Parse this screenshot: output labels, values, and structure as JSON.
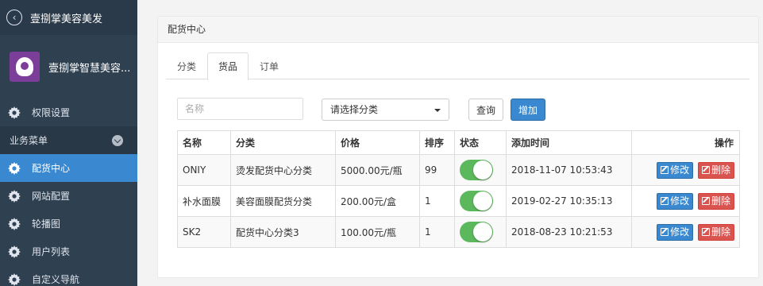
{
  "sidebar": {
    "app_title": "壹捌掌美容美发",
    "profile_name": "壹捌掌智慧美容...",
    "item_permissions": "权限设置",
    "section_label": "业务菜单",
    "items": [
      {
        "label": "配货中心",
        "active": true
      },
      {
        "label": "网站配置"
      },
      {
        "label": "轮播图"
      },
      {
        "label": "用户列表"
      },
      {
        "label": "自定义导航"
      }
    ]
  },
  "panel": {
    "title": "配货中心",
    "tabs": [
      {
        "label": "分类"
      },
      {
        "label": "货品",
        "active": true
      },
      {
        "label": "订单"
      }
    ]
  },
  "filters": {
    "name_placeholder": "名称",
    "category_select": "请选择分类",
    "query_button": "查询",
    "add_button": "增加"
  },
  "table": {
    "headers": [
      "名称",
      "分类",
      "价格",
      "排序",
      "状态",
      "添加时间",
      "操作"
    ],
    "rows": [
      {
        "name": "ONIY",
        "category": "烫发配货中心分类",
        "price": "5000.00元/瓶",
        "sort": "99",
        "status": "on",
        "time": "2018-11-07 10:53:43"
      },
      {
        "name": "补水面膜",
        "category": "美容面膜配货分类",
        "price": "200.00元/盒",
        "sort": "1",
        "status": "on",
        "time": "2019-02-27 10:35:13"
      },
      {
        "name": "SK2",
        "category": "配货中心分类3",
        "price": "100.00元/瓶",
        "sort": "1",
        "status": "on",
        "time": "2018-08-23 10:21:53"
      }
    ],
    "edit_label": "修改",
    "delete_label": "删除"
  },
  "colors": {
    "sidebar_bg": "#2f4050",
    "active_blue": "#3a89d0",
    "toggle_green": "#5cb85c",
    "danger_red": "#d9534f"
  }
}
